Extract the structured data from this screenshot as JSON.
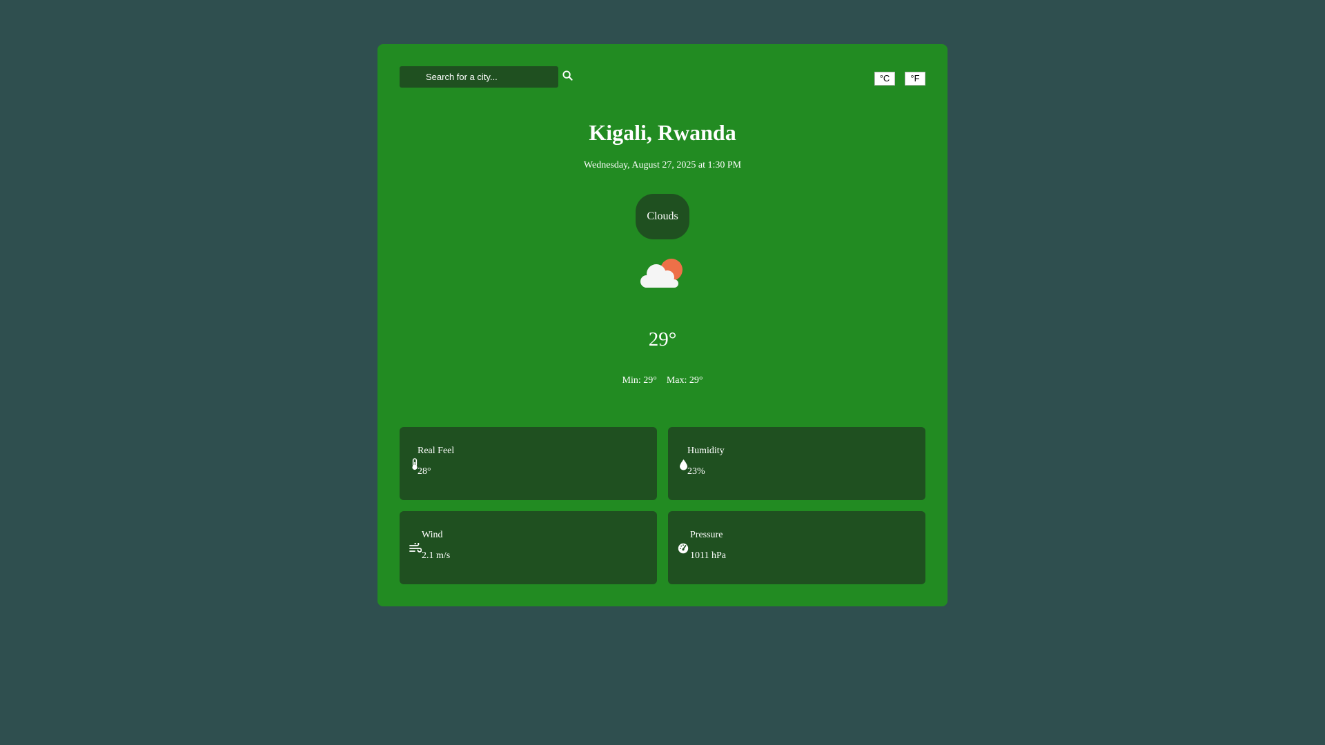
{
  "search": {
    "placeholder": "Search for a city..."
  },
  "units": {
    "celsius_label": "°C",
    "fahrenheit_label": "°F"
  },
  "location": {
    "city": "Kigali, Rwanda",
    "datetime": "Wednesday, August 27, 2025 at 1:30 PM"
  },
  "current": {
    "condition": "Clouds",
    "icon": "partly-cloudy-icon",
    "temperature": "29°",
    "min": "Min: 29°",
    "max": "Max: 29°"
  },
  "details": [
    {
      "label": "Real Feel",
      "value": "28°",
      "icon": "thermometer-icon"
    },
    {
      "label": "Humidity",
      "value": "23%",
      "icon": "droplet-icon"
    },
    {
      "label": "Wind",
      "value": "2.1 m/s",
      "icon": "wind-icon"
    },
    {
      "label": "Pressure",
      "value": "1011 hPa",
      "icon": "gauge-icon"
    }
  ],
  "colors": {
    "page_background": "#2f4f4f",
    "card_background": "#228b22",
    "tile_background": "#1f5020",
    "sun": "#ee7048",
    "cloud": "#f5f5f5"
  }
}
